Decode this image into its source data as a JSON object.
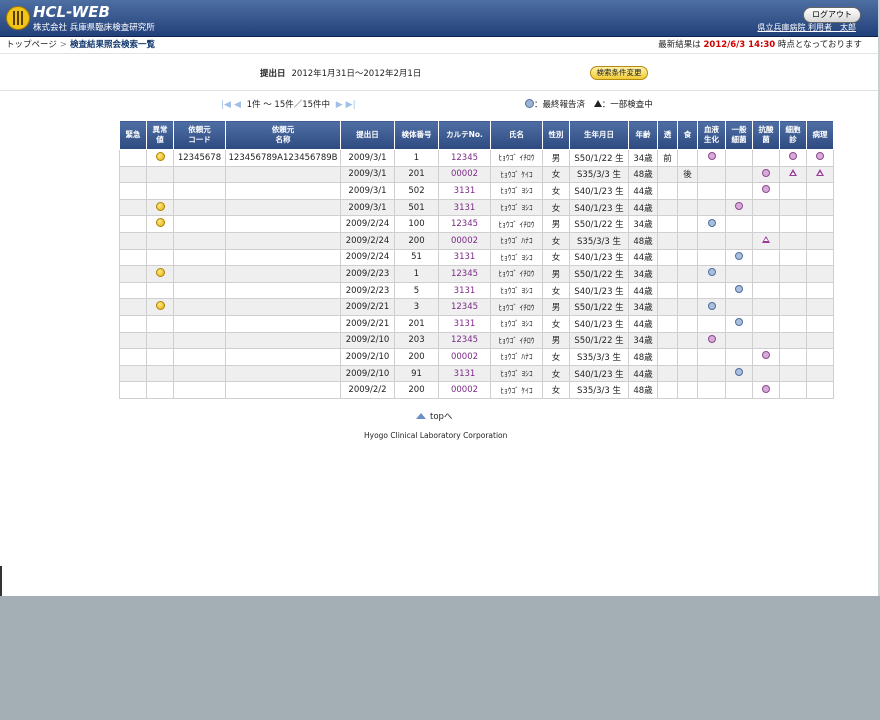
{
  "header": {
    "logo_text": "HCL-WEB",
    "company": "株式会社 兵庫県臨床検査研究所",
    "logout_label": "ログアウト",
    "user_line": "県立兵庫病院 利用者　太郎"
  },
  "breadcrumb": {
    "home": "トップページ",
    "sep": ">",
    "current": "検査結果照会検索一覧"
  },
  "latest": {
    "prefix": "最新結果は",
    "datetime": "2012/6/3 14:30",
    "suffix": "時点となっております"
  },
  "condition": {
    "label": "提出日",
    "value": "2012年1月31日〜2012年2月1日",
    "change_label": "検索条件変更"
  },
  "pager": {
    "text": "1件 〜 15件／15件中"
  },
  "legend": {
    "final": "：最終報告済",
    "partial": "：一部検査中"
  },
  "columns": [
    "緊急",
    "異常値",
    "依頼元コード",
    "依頼元名称",
    "提出日",
    "検体番号",
    "カルテNo.",
    "氏名",
    "性別",
    "生年月日",
    "年齢",
    "透",
    "食",
    "血液生化",
    "一般細菌",
    "抗酸菌",
    "細胞診",
    "病理"
  ],
  "column_lines": [
    [
      "緊急"
    ],
    [
      "異常",
      "値"
    ],
    [
      "依頼元",
      "コード"
    ],
    [
      "依頼元",
      "名称"
    ],
    [
      "提出日"
    ],
    [
      "検体番号"
    ],
    [
      "カルテNo."
    ],
    [
      "氏名"
    ],
    [
      "性別"
    ],
    [
      "生年月日"
    ],
    [
      "年齢"
    ],
    [
      "透"
    ],
    [
      "食"
    ],
    [
      "血液",
      "生化"
    ],
    [
      "一般",
      "細菌"
    ],
    [
      "抗酸",
      "菌"
    ],
    [
      "細胞",
      "診"
    ],
    [
      "病理"
    ]
  ],
  "rows": [
    {
      "urgent": "",
      "abnormal": true,
      "code": "12345678",
      "name_src": "123456789A123456789B",
      "date": "2009/3/1",
      "specimen": "1",
      "karte": "12345",
      "patient": "ﾋｮｳｺﾞ ｲﾁﾛｳ",
      "sex": "男",
      "dob": "S50/1/22 生",
      "age": "34歳",
      "dialysis": "前",
      "meal": "",
      "bio": "pink",
      "bact": "",
      "afb": "",
      "cyto": "pink",
      "path": "pink"
    },
    {
      "urgent": "",
      "abnormal": false,
      "code": "",
      "name_src": "",
      "date": "2009/3/1",
      "specimen": "201",
      "karte": "00002",
      "patient": "ﾋｮｳｺﾞ ｹｲｺ",
      "sex": "女",
      "dob": "S35/3/3 生",
      "age": "48歳",
      "dialysis": "",
      "meal": "後",
      "bio": "",
      "bact": "",
      "afb": "pink",
      "cyto": "tri",
      "path": "tri"
    },
    {
      "urgent": "",
      "abnormal": false,
      "code": "",
      "name_src": "",
      "date": "2009/3/1",
      "specimen": "502",
      "karte": "3131",
      "patient": "ﾋｮｳｺﾞ ﾖｼｺ",
      "sex": "女",
      "dob": "S40/1/23 生",
      "age": "44歳",
      "dialysis": "",
      "meal": "",
      "bio": "",
      "bact": "",
      "afb": "pink",
      "cyto": "",
      "path": ""
    },
    {
      "urgent": "",
      "abnormal": true,
      "code": "",
      "name_src": "",
      "date": "2009/3/1",
      "specimen": "501",
      "karte": "3131",
      "patient": "ﾋｮｳｺﾞ ﾖｼｺ",
      "sex": "女",
      "dob": "S40/1/23 生",
      "age": "44歳",
      "dialysis": "",
      "meal": "",
      "bio": "",
      "bact": "pink",
      "afb": "",
      "cyto": "",
      "path": ""
    },
    {
      "urgent": "",
      "abnormal": true,
      "code": "",
      "name_src": "",
      "date": "2009/2/24",
      "specimen": "100",
      "karte": "12345",
      "patient": "ﾋｮｳｺﾞ ｲﾁﾛｳ",
      "sex": "男",
      "dob": "S50/1/22 生",
      "age": "34歳",
      "dialysis": "",
      "meal": "",
      "bio": "blue",
      "bact": "",
      "afb": "",
      "cyto": "",
      "path": ""
    },
    {
      "urgent": "",
      "abnormal": false,
      "code": "",
      "name_src": "",
      "date": "2009/2/24",
      "specimen": "200",
      "karte": "00002",
      "patient": "ﾋｮｳｺﾞ ﾊﾅｺ",
      "sex": "女",
      "dob": "S35/3/3 生",
      "age": "48歳",
      "dialysis": "",
      "meal": "",
      "bio": "",
      "bact": "",
      "afb": "tri",
      "cyto": "",
      "path": ""
    },
    {
      "urgent": "",
      "abnormal": false,
      "code": "",
      "name_src": "",
      "date": "2009/2/24",
      "specimen": "51",
      "karte": "3131",
      "patient": "ﾋｮｳｺﾞ ﾖｼｺ",
      "sex": "女",
      "dob": "S40/1/23 生",
      "age": "44歳",
      "dialysis": "",
      "meal": "",
      "bio": "",
      "bact": "blue",
      "afb": "",
      "cyto": "",
      "path": ""
    },
    {
      "urgent": "",
      "abnormal": true,
      "code": "",
      "name_src": "",
      "date": "2009/2/23",
      "specimen": "1",
      "karte": "12345",
      "patient": "ﾋｮｳｺﾞ ｲﾁﾛｳ",
      "sex": "男",
      "dob": "S50/1/22 生",
      "age": "34歳",
      "dialysis": "",
      "meal": "",
      "bio": "blue",
      "bact": "",
      "afb": "",
      "cyto": "",
      "path": ""
    },
    {
      "urgent": "",
      "abnormal": false,
      "code": "",
      "name_src": "",
      "date": "2009/2/23",
      "specimen": "5",
      "karte": "3131",
      "patient": "ﾋｮｳｺﾞ ﾖｼｺ",
      "sex": "女",
      "dob": "S40/1/23 生",
      "age": "44歳",
      "dialysis": "",
      "meal": "",
      "bio": "",
      "bact": "blue",
      "afb": "",
      "cyto": "",
      "path": ""
    },
    {
      "urgent": "",
      "abnormal": true,
      "code": "",
      "name_src": "",
      "date": "2009/2/21",
      "specimen": "3",
      "karte": "12345",
      "patient": "ﾋｮｳｺﾞ ｲﾁﾛｳ",
      "sex": "男",
      "dob": "S50/1/22 生",
      "age": "34歳",
      "dialysis": "",
      "meal": "",
      "bio": "blue",
      "bact": "",
      "afb": "",
      "cyto": "",
      "path": ""
    },
    {
      "urgent": "",
      "abnormal": false,
      "code": "",
      "name_src": "",
      "date": "2009/2/21",
      "specimen": "201",
      "karte": "3131",
      "patient": "ﾋｮｳｺﾞ ﾖｼｺ",
      "sex": "女",
      "dob": "S40/1/23 生",
      "age": "44歳",
      "dialysis": "",
      "meal": "",
      "bio": "",
      "bact": "blue",
      "afb": "",
      "cyto": "",
      "path": ""
    },
    {
      "urgent": "",
      "abnormal": false,
      "code": "",
      "name_src": "",
      "date": "2009/2/10",
      "specimen": "203",
      "karte": "12345",
      "patient": "ﾋｮｳｺﾞ ｲﾁﾛｳ",
      "sex": "男",
      "dob": "S50/1/22 生",
      "age": "34歳",
      "dialysis": "",
      "meal": "",
      "bio": "pink",
      "bact": "",
      "afb": "",
      "cyto": "",
      "path": ""
    },
    {
      "urgent": "",
      "abnormal": false,
      "code": "",
      "name_src": "",
      "date": "2009/2/10",
      "specimen": "200",
      "karte": "00002",
      "patient": "ﾋｮｳｺﾞ ﾊﾅｺ",
      "sex": "女",
      "dob": "S35/3/3 生",
      "age": "48歳",
      "dialysis": "",
      "meal": "",
      "bio": "",
      "bact": "",
      "afb": "pink",
      "cyto": "",
      "path": ""
    },
    {
      "urgent": "",
      "abnormal": false,
      "code": "",
      "name_src": "",
      "date": "2009/2/10",
      "specimen": "91",
      "karte": "3131",
      "patient": "ﾋｮｳｺﾞ ﾖｼｺ",
      "sex": "女",
      "dob": "S40/1/23 生",
      "age": "44歳",
      "dialysis": "",
      "meal": "",
      "bio": "",
      "bact": "blue",
      "afb": "",
      "cyto": "",
      "path": ""
    },
    {
      "urgent": "",
      "abnormal": false,
      "code": "",
      "name_src": "",
      "date": "2009/2/2",
      "specimen": "200",
      "karte": "00002",
      "patient": "ﾋｮｳｺﾞ ｹｲｺ",
      "sex": "女",
      "dob": "S35/3/3 生",
      "age": "48歳",
      "dialysis": "",
      "meal": "",
      "bio": "",
      "bact": "",
      "afb": "pink",
      "cyto": "",
      "path": ""
    }
  ],
  "footer": {
    "top_link": "topへ",
    "corp": "Hyogo Clinical Laboratory Corporation"
  }
}
